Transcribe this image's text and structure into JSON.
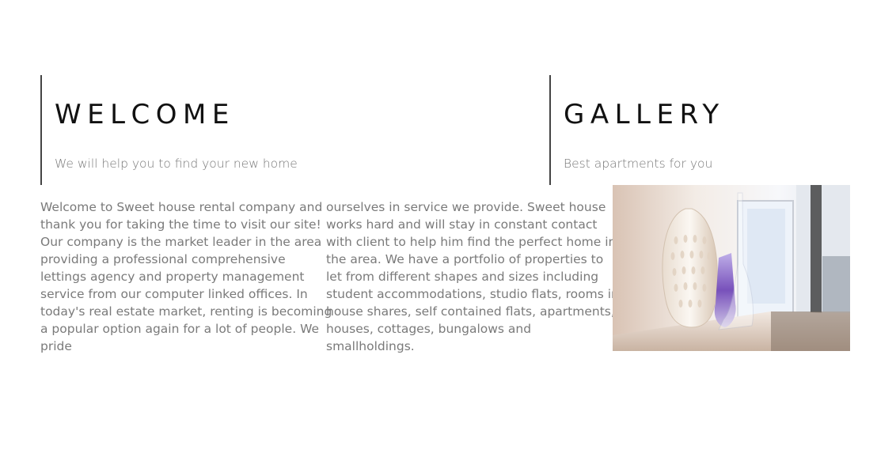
{
  "welcome": {
    "title": "WELCOME",
    "subtitle": "We will help you to find your new home",
    "column1_lines": [
      "Welcome to Sweet house rental company and",
      "thank you for taking the time to visit our site!",
      "Our company is the market leader in the area",
      "providing a professional comprehensive",
      "lettings agency and property management",
      "service from our computer linked offices. In",
      "today's real estate market, renting is becoming",
      "a popular option again for a lot of people. We",
      "pride"
    ],
    "column2_lines": [
      "ourselves in service we provide. Sweet house",
      "works hard and will stay in constant contact",
      "with client to help him find the perfect home in",
      "the area. We have a portfolio of properties to",
      "let from different shapes and sizes including",
      "student accommodations, studio flats, rooms in",
      "house shares, self contained flats, apartments,",
      "houses, cottages, bungalows and",
      "smallholdings."
    ]
  },
  "gallery": {
    "title": "GALLERY",
    "subtitle": "Best apartments for you",
    "image_icon": "interior-photo-vases"
  },
  "colors": {
    "title": "#111111",
    "body_text": "#7a7a7a",
    "divider": "#444444",
    "accent_purple": "#6a3fb5"
  }
}
